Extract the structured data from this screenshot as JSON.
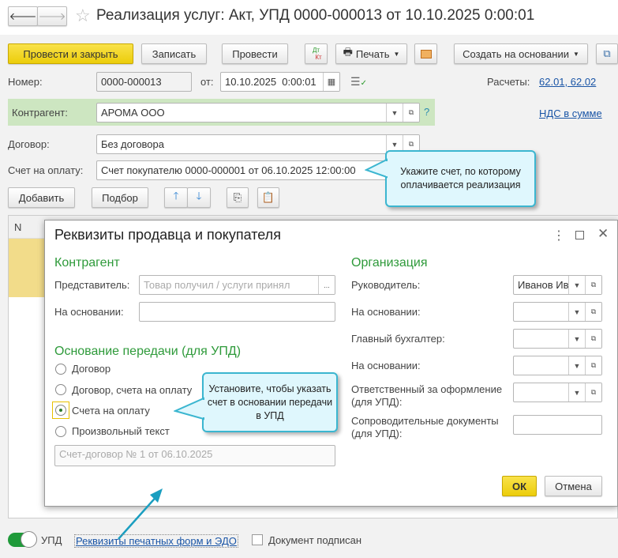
{
  "window": {
    "title": "Реализация услуг: Акт, УПД 0000-000013 от 10.10.2025 0:00:01"
  },
  "toolbar": {
    "post_close": "Провести и закрыть",
    "save": "Записать",
    "post": "Провести",
    "dtkt_dt": "Дт",
    "dtkt_kt": "Кт",
    "print": "Печать",
    "create_based": "Создать на основании"
  },
  "form": {
    "number_label": "Номер:",
    "number": "0000-000013",
    "date_label": "от:",
    "date": "10.10.2025  0:00:01",
    "settlements_label": "Расчеты:",
    "settlements_link": "62.01, 62.02",
    "counterparty_label": "Контрагент:",
    "counterparty": "АРОМА ООО",
    "help": "?",
    "vat_link": "НДС в сумме",
    "contract_label": "Договор:",
    "contract": "Без договора",
    "invoice_label": "Счет на оплату:",
    "invoice": "Счет покупателю 0000-000001 от 06.10.2025 12:00:00",
    "add": "Добавить",
    "pick": "Подбор",
    "table_col_n": "N"
  },
  "tip1": "Укажите счет, по которому оплачивается реализация",
  "dialog": {
    "title": "Реквизиты продавца и покупателя",
    "counterparty_heading": "Контрагент",
    "representative_label": "Представитель:",
    "representative_placeholder": "Товар получил / услуги принял",
    "ellipsis": "...",
    "basis_label": "На основании:",
    "transfer_heading": "Основание передачи (для УПД)",
    "radios": [
      {
        "label": "Договор",
        "checked": false
      },
      {
        "label": "Договор, счета на оплату",
        "checked": false
      },
      {
        "label": "Счета на оплату",
        "checked": true
      },
      {
        "label": "Произвольный текст",
        "checked": false
      }
    ],
    "free_text": "Счет-договор № 1 от 06.10.2025",
    "org_heading": "Организация",
    "head_label": "Руководитель:",
    "head_value": "Иванов Ив",
    "head_basis_label": "На основании:",
    "accountant_label": "Главный бухгалтер:",
    "acc_basis_label": "На основании:",
    "responsible_label": "Ответственный за оформление (для УПД):",
    "docs_label": "Сопроводительные документы (для УПД):",
    "ok": "ОК",
    "cancel": "Отмена"
  },
  "tip2": "Установите, чтобы указать счет в основании передачи в УПД",
  "footer": {
    "upd_label": "УПД",
    "upd_on": true,
    "print_link": "Реквизиты печатных форм и ЭДО",
    "signed_label": "Документ подписан",
    "signed": false
  },
  "colors": {
    "accent_yellow": "#f2d51f",
    "heading_green": "#2e9a3a",
    "link": "#1a55a6",
    "tip_border": "#3bb6d0"
  }
}
